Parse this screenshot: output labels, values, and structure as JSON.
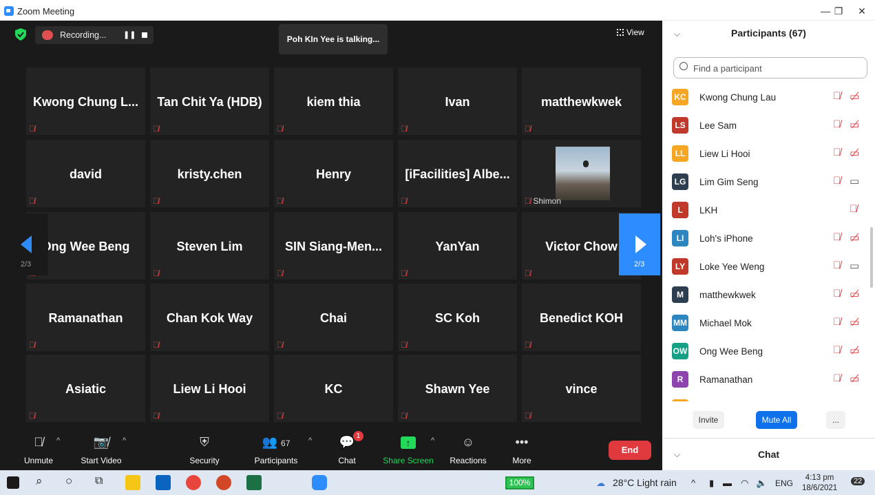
{
  "window": {
    "title": "Zoom Meeting"
  },
  "topbar": {
    "recording_label": "Recording...",
    "talking": "Poh KIn Yee is talking...",
    "view_label": "View"
  },
  "grid": {
    "page_left": "2/3",
    "page_right": "2/3",
    "tiles": [
      "Kwong  Chung  L...",
      "Tan Chit Ya (HDB)",
      "kiem thia",
      "Ivan",
      "matthewkwek",
      "david",
      "kristy.chen",
      "Henry",
      "[iFacilities]  Albe...",
      "",
      "Ong Wee Beng",
      "Steven Lim",
      "SIN  Siang-Men...",
      "YanYan",
      "Victor Chow",
      "Ramanathan",
      "Chan Kok Way",
      "Chai",
      "SC Koh",
      "Benedict KOH",
      "Asiatic",
      "Liew Li Hooi",
      "KC",
      "Shawn Yee",
      "vince"
    ],
    "video_tile_name": "Shimon"
  },
  "toolbar": {
    "unmute": "Unmute",
    "start_video": "Start Video",
    "security": "Security",
    "participants": "Participants",
    "participants_count": "67",
    "chat": "Chat",
    "chat_badge": "1",
    "share_screen": "Share Screen",
    "reactions": "Reactions",
    "more": "More",
    "end": "End"
  },
  "panel": {
    "title": "Participants (67)",
    "search_placeholder": "Find a participant",
    "participants": [
      {
        "initials": "KC",
        "name": "Kwong Chung Lau",
        "color": "#F5A623",
        "video": "off"
      },
      {
        "initials": "LS",
        "name": "Lee Sam",
        "color": "#C0392B",
        "video": "off"
      },
      {
        "initials": "LL",
        "name": "Liew Li Hooi",
        "color": "#F5A623",
        "video": "off"
      },
      {
        "initials": "LG",
        "name": "Lim Gim Seng",
        "color": "#2C3E50",
        "video": "on"
      },
      {
        "initials": "L",
        "name": "LKH",
        "color": "#C0392B",
        "video": "none"
      },
      {
        "initials": "LI",
        "name": "Loh's iPhone",
        "color": "#2E86C1",
        "video": "off"
      },
      {
        "initials": "LY",
        "name": "Loke Yee Weng",
        "color": "#C0392B",
        "video": "on"
      },
      {
        "initials": "M",
        "name": "matthewkwek",
        "color": "#2C3E50",
        "video": "off"
      },
      {
        "initials": "MM",
        "name": "Michael Mok",
        "color": "#2E86C1",
        "video": "off"
      },
      {
        "initials": "OW",
        "name": "Ong Wee Beng",
        "color": "#16A085",
        "video": "off"
      },
      {
        "initials": "R",
        "name": "Ramanathan",
        "color": "#8E44AD",
        "video": "off"
      }
    ],
    "invite": "Invite",
    "mute_all": "Mute All",
    "more": "...",
    "chat_title": "Chat"
  },
  "taskbar": {
    "battery": "100%",
    "weather": "28°C  Light rain",
    "language": "ENG",
    "time": "4:13 pm",
    "date": "18/6/2021",
    "notifications": "22"
  }
}
